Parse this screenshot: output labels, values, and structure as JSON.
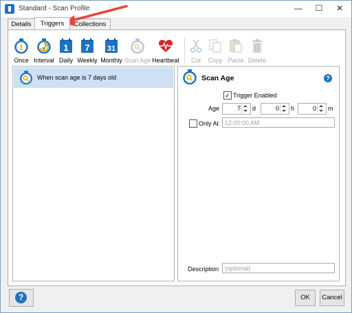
{
  "window": {
    "title": "Standard - Scan Profile"
  },
  "tabs": [
    {
      "label": "Details"
    },
    {
      "label": "Triggers"
    },
    {
      "label": "Collections"
    }
  ],
  "toolbar": {
    "once": "Once",
    "interval": "Interval",
    "daily": "Daily",
    "weekly": "Weekly",
    "monthly": "Monthly",
    "scan_age": "Scan Age",
    "heartbeat": "Heartbeat",
    "cut": "Cut",
    "copy": "Copy",
    "paste": "Paste",
    "delete": "Delete",
    "daily_num": "1",
    "weekly_num": "7",
    "monthly_num": "31"
  },
  "list": {
    "items": [
      {
        "label": "When scan age is 7 days old"
      }
    ]
  },
  "detail": {
    "title": "Scan Age",
    "trigger_enabled": "Trigger Enabled",
    "age_label": "Age",
    "days_value": "7",
    "days_unit": "d",
    "hours_value": "0",
    "hours_unit": "h",
    "minutes_value": "0",
    "minutes_unit": "m",
    "only_at_label": "Only At",
    "only_at_placeholder": "12:00:00 AM",
    "description_label": "Description",
    "description_placeholder": "(optional)"
  },
  "footer": {
    "ok": "OK",
    "cancel": "Cancel",
    "help_glyph": "?"
  },
  "colors": {
    "accent": "#1e73be",
    "selection": "#cde0f4",
    "arrow": "#e8453c",
    "heart": "#d9262c"
  }
}
